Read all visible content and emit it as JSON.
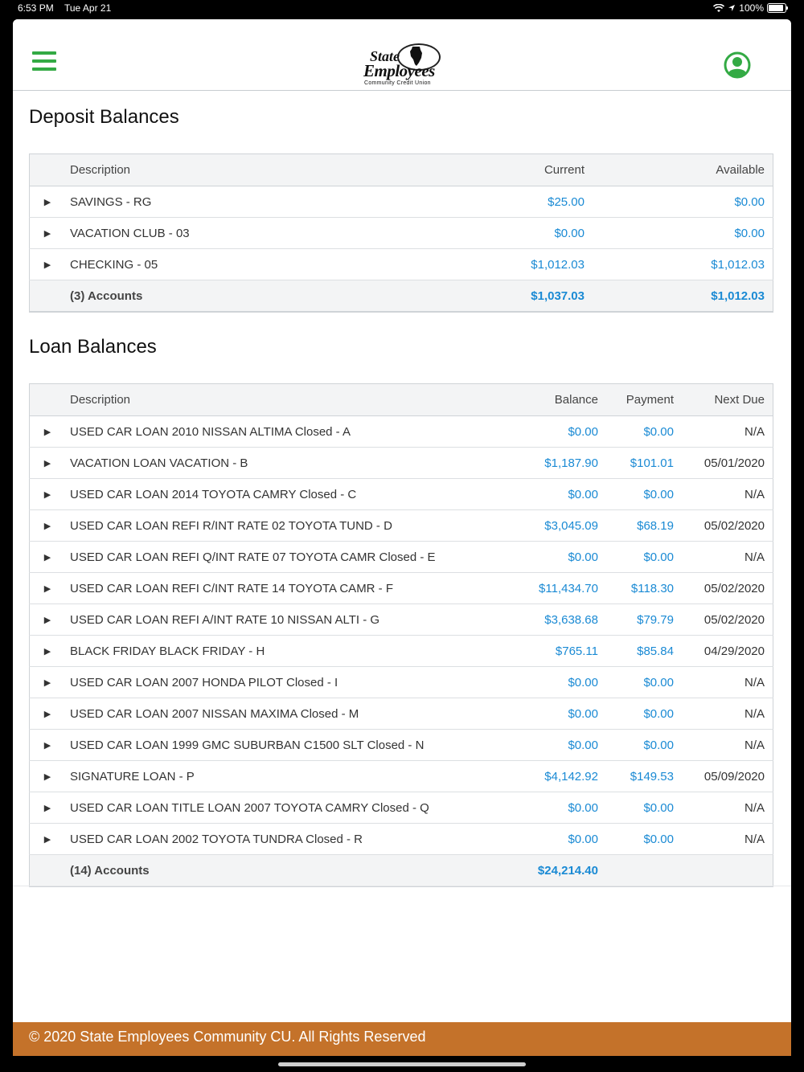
{
  "status_bar": {
    "time": "6:53 PM",
    "date": "Tue Apr 21",
    "battery": "100%",
    "battery_level": 1.0,
    "icons": [
      "wifi-icon",
      "location-icon",
      "battery-icon"
    ]
  },
  "brand": {
    "logo_line1": "State",
    "logo_line2": "Employees",
    "logo_line3": "Community Credit Union",
    "accent": "#33aa44",
    "link_color": "#1a8ad4",
    "footer_color": "#c4722a"
  },
  "deposit": {
    "title": "Deposit Balances",
    "headers": {
      "description": "Description",
      "current": "Current",
      "available": "Available"
    },
    "rows": [
      {
        "description": "SAVINGS - RG",
        "current": "$25.00",
        "available": "$0.00"
      },
      {
        "description": "VACATION CLUB - 03",
        "current": "$0.00",
        "available": "$0.00"
      },
      {
        "description": "CHECKING - 05",
        "current": "$1,012.03",
        "available": "$1,012.03"
      }
    ],
    "total": {
      "label": "(3) Accounts",
      "current": "$1,037.03",
      "available": "$1,012.03"
    }
  },
  "loan": {
    "title": "Loan Balances",
    "headers": {
      "description": "Description",
      "balance": "Balance",
      "payment": "Payment",
      "next_due": "Next Due"
    },
    "rows": [
      {
        "description": "USED CAR LOAN 2010 NISSAN ALTIMA Closed - A",
        "balance": "$0.00",
        "payment": "$0.00",
        "next_due": "N/A"
      },
      {
        "description": "VACATION LOAN VACATION - B",
        "balance": "$1,187.90",
        "payment": "$101.01",
        "next_due": "05/01/2020"
      },
      {
        "description": "USED CAR LOAN 2014 TOYOTA CAMRY Closed - C",
        "balance": "$0.00",
        "payment": "$0.00",
        "next_due": "N/A"
      },
      {
        "description": "USED CAR LOAN REFI R/INT RATE 02 TOYOTA TUND - D",
        "balance": "$3,045.09",
        "payment": "$68.19",
        "next_due": "05/02/2020"
      },
      {
        "description": "USED CAR LOAN REFI Q/INT RATE 07 TOYOTA CAMR Closed - E",
        "balance": "$0.00",
        "payment": "$0.00",
        "next_due": "N/A"
      },
      {
        "description": "USED CAR LOAN REFI C/INT RATE 14 TOYOTA CAMR - F",
        "balance": "$11,434.70",
        "payment": "$118.30",
        "next_due": "05/02/2020"
      },
      {
        "description": "USED CAR LOAN REFI A/INT RATE 10 NISSAN ALTI - G",
        "balance": "$3,638.68",
        "payment": "$79.79",
        "next_due": "05/02/2020"
      },
      {
        "description": "BLACK FRIDAY BLACK FRIDAY - H",
        "balance": "$765.11",
        "payment": "$85.84",
        "next_due": "04/29/2020"
      },
      {
        "description": "USED CAR LOAN 2007 HONDA PILOT Closed - I",
        "balance": "$0.00",
        "payment": "$0.00",
        "next_due": "N/A"
      },
      {
        "description": "USED CAR LOAN 2007 NISSAN MAXIMA Closed - M",
        "balance": "$0.00",
        "payment": "$0.00",
        "next_due": "N/A"
      },
      {
        "description": "USED CAR LOAN 1999 GMC SUBURBAN C1500 SLT Closed - N",
        "balance": "$0.00",
        "payment": "$0.00",
        "next_due": "N/A"
      },
      {
        "description": "SIGNATURE LOAN - P",
        "balance": "$4,142.92",
        "payment": "$149.53",
        "next_due": "05/09/2020"
      },
      {
        "description": "USED CAR LOAN TITLE LOAN 2007 TOYOTA CAMRY Closed - Q",
        "balance": "$0.00",
        "payment": "$0.00",
        "next_due": "N/A"
      },
      {
        "description": "USED CAR LOAN 2002 TOYOTA TUNDRA Closed - R",
        "balance": "$0.00",
        "payment": "$0.00",
        "next_due": "N/A"
      }
    ],
    "total": {
      "label": "(14) Accounts",
      "balance": "$24,214.40"
    }
  },
  "footer": {
    "text": "© 2020 State Employees Community CU. All Rights Reserved"
  }
}
